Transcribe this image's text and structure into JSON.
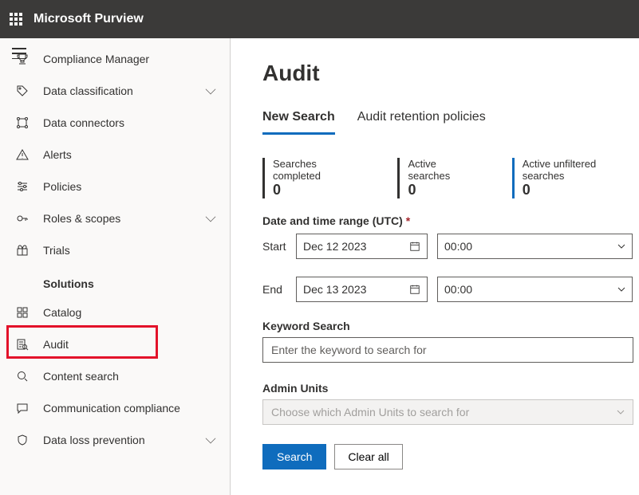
{
  "header": {
    "brand": "Microsoft Purview"
  },
  "sidebar": {
    "items": [
      {
        "label": "Compliance Manager",
        "expandable": false
      },
      {
        "label": "Data classification",
        "expandable": true
      },
      {
        "label": "Data connectors",
        "expandable": false
      },
      {
        "label": "Alerts",
        "expandable": false
      },
      {
        "label": "Policies",
        "expandable": false
      },
      {
        "label": "Roles & scopes",
        "expandable": true
      },
      {
        "label": "Trials",
        "expandable": false
      }
    ],
    "section_label": "Solutions",
    "solutions": [
      {
        "label": "Catalog",
        "expandable": false
      },
      {
        "label": "Audit",
        "expandable": false,
        "highlighted": true,
        "active": true
      },
      {
        "label": "Content search",
        "expandable": false
      },
      {
        "label": "Communication compliance",
        "expandable": false
      },
      {
        "label": "Data loss prevention",
        "expandable": true
      }
    ]
  },
  "main": {
    "title": "Audit",
    "tabs": [
      {
        "label": "New Search",
        "active": true
      },
      {
        "label": "Audit retention policies",
        "active": false
      }
    ],
    "stats": [
      {
        "label": "Searches completed",
        "value": "0",
        "accent": "dark"
      },
      {
        "label": "Active searches",
        "value": "0",
        "accent": "dark"
      },
      {
        "label": "Active unfiltered searches",
        "value": "0",
        "accent": "blue"
      }
    ],
    "date_section": {
      "title": "Date and time range (UTC)",
      "required": "*",
      "start_label": "Start",
      "start_date": "Dec 12 2023",
      "start_time": "00:00",
      "end_label": "End",
      "end_date": "Dec 13 2023",
      "end_time": "00:00"
    },
    "keyword": {
      "title": "Keyword Search",
      "placeholder": "Enter the keyword to search for"
    },
    "admin": {
      "title": "Admin Units",
      "placeholder": "Choose which Admin Units to search for"
    },
    "buttons": {
      "search": "Search",
      "clear": "Clear all"
    }
  }
}
